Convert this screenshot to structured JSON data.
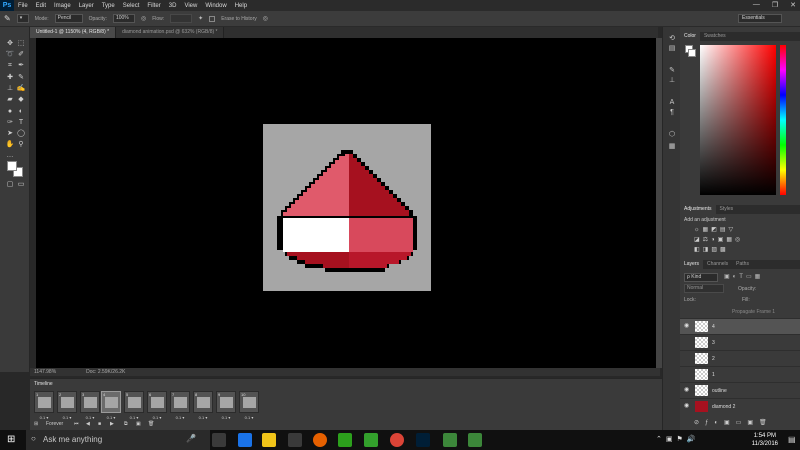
{
  "app": {
    "logo": "Ps"
  },
  "menu": [
    "File",
    "Edit",
    "Image",
    "Layer",
    "Type",
    "Select",
    "Filter",
    "3D",
    "View",
    "Window",
    "Help"
  ],
  "window_controls": [
    "—",
    "❐",
    "✕"
  ],
  "options_bar": {
    "mode_label": "Mode:",
    "mode_value": "Pencil",
    "opacity_label": "Opacity:",
    "opacity_value": "100%",
    "flow_label": "Flow:",
    "erase_history": "Erase to History",
    "workspace": "Essentials"
  },
  "doc_tabs": [
    "Untitled-1 @ 1150% (4, RGB/8) *",
    "diamond animation.psd @ 632% (RGB/8) *"
  ],
  "status": {
    "zoom": "1147.98%",
    "doc": "Doc: 2.59K/26.2K"
  },
  "timeline": {
    "title": "Timeline",
    "frames": [
      {
        "num": "1",
        "delay": "0.1 ▾"
      },
      {
        "num": "2",
        "delay": "0.1 ▾"
      },
      {
        "num": "3",
        "delay": "0.1 ▾"
      },
      {
        "num": "4",
        "delay": "0.1 ▾"
      },
      {
        "num": "5",
        "delay": "0.1 ▾"
      },
      {
        "num": "6",
        "delay": "0.1 ▾"
      },
      {
        "num": "7",
        "delay": "0.1 ▾"
      },
      {
        "num": "8",
        "delay": "0.1 ▾"
      },
      {
        "num": "9",
        "delay": "0.1 ▾"
      },
      {
        "num": "10",
        "delay": "0.1 ▾"
      }
    ],
    "loop": "Forever"
  },
  "panels": {
    "color_tabs": [
      "Color",
      "Swatches"
    ],
    "adjust_tabs": [
      "Adjustments",
      "Styles"
    ],
    "adjust_label": "Add an adjustment",
    "layer_tabs": [
      "Layers",
      "Channels",
      "Paths"
    ],
    "kind": "ρ Kind",
    "blend": "Normal",
    "opacity_label": "Opacity:",
    "lock_label": "Lock:",
    "fill_label": "Fill:",
    "propagate": "Propagate Frame 1",
    "layers": [
      {
        "name": "4",
        "selected": true,
        "visible": true
      },
      {
        "name": "3",
        "selected": false,
        "visible": false
      },
      {
        "name": "2",
        "selected": false,
        "visible": false
      },
      {
        "name": "1",
        "selected": false,
        "visible": false
      },
      {
        "name": "outline",
        "selected": false,
        "visible": true
      },
      {
        "name": "diamond 2",
        "selected": false,
        "visible": true
      }
    ]
  },
  "taskbar": {
    "search": "Ask me anything",
    "time": "1:54 PM",
    "date": "11/3/2016",
    "apps": [
      "#3a3a3a",
      "#1a73e8",
      "#f0c419",
      "#3a3a3a",
      "#e66000",
      "#2ca01c",
      "#33a02c",
      "#db4437",
      "#001e36",
      "#3c873a",
      "#3c873a"
    ]
  },
  "colors": {
    "diamond_light": "#e05a6b",
    "diamond_dark": "#a6111f",
    "diamond_pale": "#ffffff",
    "diamond_mid": "#d8495c",
    "outline": "#000000"
  }
}
